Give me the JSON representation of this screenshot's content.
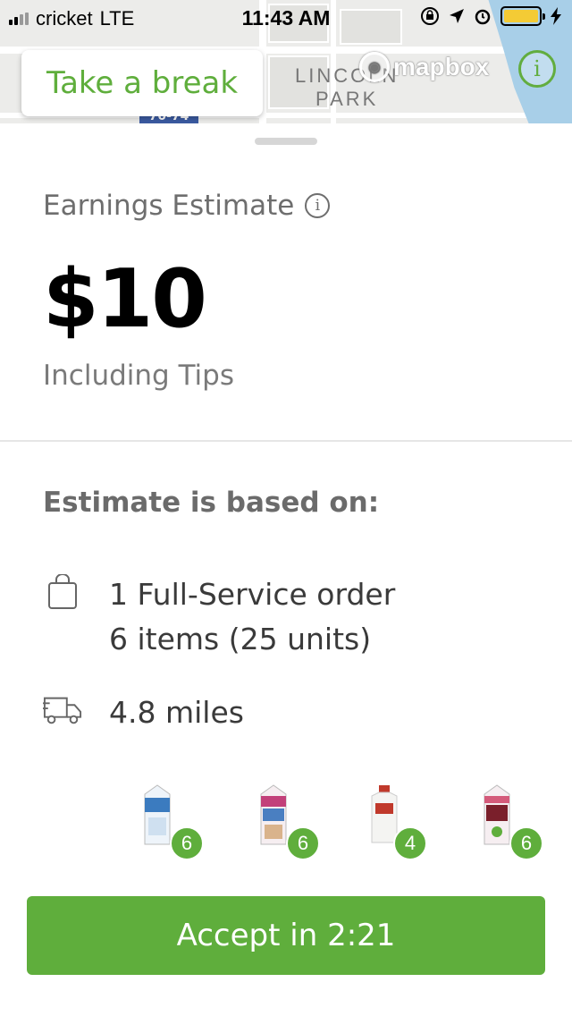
{
  "status_bar": {
    "carrier": "cricket",
    "network": "LTE",
    "time": "11:43 AM"
  },
  "map": {
    "park_label_line1": "LINCOLN",
    "park_label_line2": "PARK",
    "highway_label": "70-74",
    "attribution": "mapbox",
    "info_glyph": "i",
    "water_color": "#a8cfe8"
  },
  "take_break_label": "Take a break",
  "earnings": {
    "label": "Earnings Estimate",
    "amount": "$10",
    "subtext": "Including Tips"
  },
  "estimate_basis": {
    "heading": "Estimate is based on:",
    "order_line1": "1 Full-Service order",
    "order_line2": "6 items (25 units)",
    "distance": "4.8 miles"
  },
  "items": [
    {
      "name": "Coconut milk carton",
      "count": "6",
      "color": "#3b7bbf"
    },
    {
      "name": "Almond milk carton",
      "count": "6",
      "color": "#c2407a"
    },
    {
      "name": "Gallon of milk",
      "count": "4",
      "color": "#c0392b"
    },
    {
      "name": "Half & Half carton",
      "count": "6",
      "color": "#7a1f2b"
    }
  ],
  "accept_button": "Accept in 2:21",
  "colors": {
    "accent_green": "#5fae3c",
    "battery_yellow": "#f4cb35"
  }
}
